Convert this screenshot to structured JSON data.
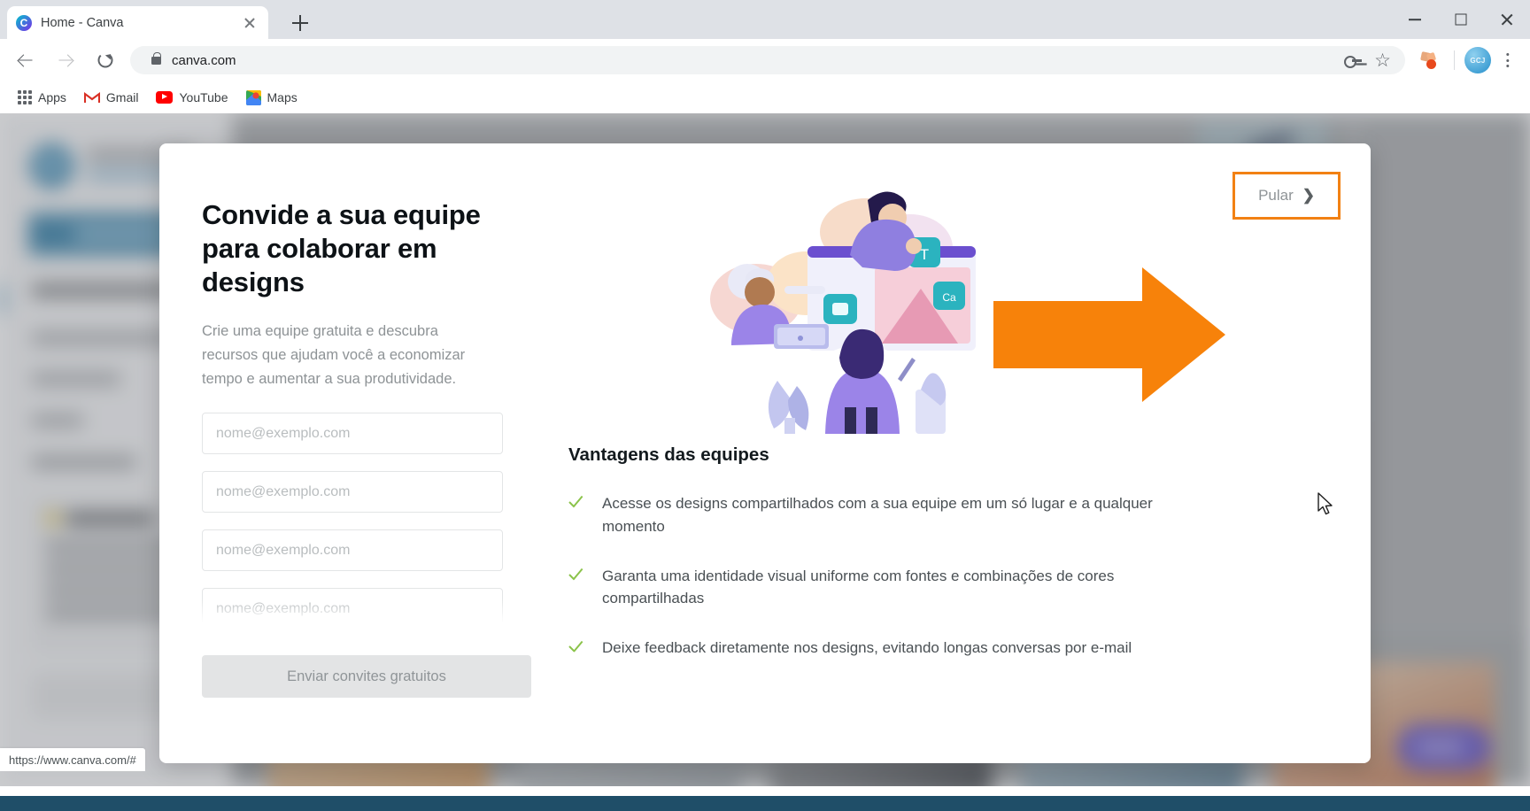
{
  "browser": {
    "tab": {
      "title": "Home - Canva",
      "favicon": "canva-favicon",
      "close": "close-tab-icon"
    },
    "new_tab_label": "+",
    "window_controls": {
      "minimize": "minimize-icon",
      "maximize": "maximize-icon",
      "close": "close-window-icon"
    },
    "nav": {
      "back": "back-arrow-icon",
      "forward": "forward-arrow-icon",
      "reload": "reload-icon"
    },
    "omnibox": {
      "url": "canva.com",
      "lock": "lock-icon",
      "key": "key-icon",
      "star": "star-icon"
    },
    "profile_initials": "GCJ",
    "bookmarks": [
      {
        "label": "Apps",
        "icon": "apps-grid-icon"
      },
      {
        "label": "Gmail",
        "icon": "gmail-icon"
      },
      {
        "label": "YouTube",
        "icon": "youtube-icon"
      },
      {
        "label": "Maps",
        "icon": "maps-icon"
      }
    ],
    "status_url": "https://www.canva.com/#"
  },
  "modal": {
    "title": "Convide a sua equipe para colaborar em designs",
    "description": "Crie uma equipe gratuita e descubra recursos que ajudam você a economizar tempo e aumentar a sua produtividade.",
    "email_placeholder": "nome@exemplo.com",
    "email_values": [
      "",
      "",
      "",
      ""
    ],
    "submit_label": "Enviar convites gratuitos",
    "skip_label": "Pular",
    "skip_chevron": "❯",
    "benefits_title": "Vantagens das equipes",
    "benefits": [
      "Acesse os designs compartilhados com a sua equipe em um só lugar e a qualquer momento",
      "Garanta uma identidade visual uniforme com fontes e combinações de cores compartilhadas",
      "Deixe feedback diretamente nos designs, evitando longas conversas por e-mail"
    ]
  },
  "annotation": {
    "arrow_color": "#F7820A",
    "highlight_color": "#F28113",
    "target": "skip-button"
  },
  "colors": {
    "accent_orange": "#F7820A",
    "check_green": "#8BC34A",
    "taskbar": "#1F4E68",
    "chrome_titlebar": "#DEE1E6"
  }
}
